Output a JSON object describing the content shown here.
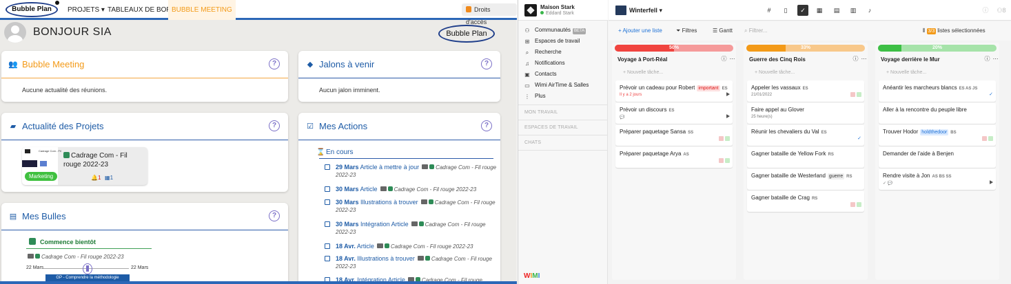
{
  "bubbleplan": {
    "logo": "Bubble Plan",
    "nav": [
      "PROJETS",
      "TABLEAUX DE BORD",
      "BUBBLE MEETING"
    ],
    "access": "Droits d'accès",
    "greeting": "BONJOUR  SIA",
    "logo2": "Bubble Plan",
    "meeting": {
      "title": "Bubble Meeting",
      "empty": "Aucune actualité des réunions."
    },
    "jalons": {
      "title": "Jalons à venir",
      "empty": "Aucun jalon imminent."
    },
    "actualite": {
      "title": "Actualité des Projets",
      "tile": {
        "thumb_text": "Cadrage Com - Fil",
        "name": "Cadrage Com - Fil rouge 2022-23",
        "tag": "Marketing",
        "alerts": "1",
        "events": "1"
      }
    },
    "actions": {
      "title": "Mes Actions",
      "section": "En cours",
      "items": [
        {
          "date": "29 Mars",
          "name": "Article à mettre à jour",
          "project": "Cadrage Com - Fil rouge",
          "project2": "2022-23"
        },
        {
          "date": "30 Mars",
          "name": "Article",
          "project": "Cadrage Com - Fil rouge 2022-23",
          "project2": ""
        },
        {
          "date": "30 Mars",
          "name": "Illustrations à trouver",
          "project": "Cadrage Com - Fil rouge",
          "project2": "2022-23"
        },
        {
          "date": "30 Mars",
          "name": "Intégration Article",
          "project": "Cadrage Com - Fil rouge",
          "project2": "2022-23"
        },
        {
          "date": "18 Avr.",
          "name": "Article",
          "project": "Cadrage Com - Fil rouge 2022-23",
          "project2": ""
        },
        {
          "date": "18 Avr.",
          "name": "Illustrations à trouver",
          "project": "Cadrage Com - Fil rouge",
          "project2": "2022-23"
        },
        {
          "date": "18 Avr.",
          "name": "Intégration Article",
          "project": "Cadrage Com - Fil rouge",
          "project2": ""
        }
      ]
    },
    "bulles": {
      "title": "Mes Bulles",
      "section": "Commence bientôt",
      "project": "Cadrage Com - Fil rouge 2022-23",
      "date_start": "22 Mars",
      "date_end": "22 Mars",
      "bar": "GP - Comprendre la méthodologie"
    }
  },
  "wimi": {
    "workspace": "Maison Stark",
    "user": "Eddard Stark",
    "nav": [
      {
        "label": "Communautés",
        "badge": "BETA",
        "icon": "communities-icon"
      },
      {
        "label": "Espaces de travail",
        "icon": "grid-icon"
      },
      {
        "label": "Recherche",
        "icon": "search-icon"
      },
      {
        "label": "Notifications",
        "icon": "bell-icon"
      },
      {
        "label": "Contacts",
        "icon": "contacts-icon"
      },
      {
        "label": "Wimi AirTime & Salles",
        "icon": "video-icon"
      },
      {
        "label": "Plus",
        "icon": "more-icon"
      }
    ],
    "sections": [
      "MON TRAVAIL",
      "ESPACES DE TRAVAIL",
      "CHATS"
    ],
    "logo": [
      "W",
      "I",
      "M",
      "I"
    ],
    "project_title": "Winterfell",
    "toolbar": {
      "add_list": "+ Ajouter une liste",
      "filters": "Filtres",
      "gantt": "Gantt",
      "filter_placeholder": "Filtrer...",
      "selected_count": "3/3",
      "selected_label": "listes sélectionnées"
    },
    "top_badge": "8",
    "new_task": "+ Nouvelle tâche...",
    "colors": {
      "red": "#f0443f",
      "orange": "#f39a18",
      "green": "#3dbf45"
    },
    "columns": [
      {
        "title": "Voyage à Port-Réal",
        "progress_label": "50%",
        "progress": 50,
        "color": "#f0443f",
        "track": "#f59a9a",
        "tasks": [
          {
            "title": "Prévoir un cadeau pour Robert",
            "tag": "important",
            "tag_color": "red",
            "initials": "ES",
            "meta": "Il y a 2 jours",
            "meta_red": true,
            "icons": [
              "play"
            ]
          },
          {
            "title": "Prévoir un discours",
            "initials": "ES",
            "meta": "💬",
            "icons": [
              "play"
            ]
          },
          {
            "title": "Préparer paquetage Sansa",
            "initials": "SS",
            "icons": [
              "r",
              "g"
            ]
          },
          {
            "title": "Préparer paquetage Arya",
            "initials": "AS",
            "icons": [
              "r",
              "g"
            ]
          }
        ]
      },
      {
        "title": "Guerre des Cinq Rois",
        "progress_label": "33%",
        "progress": 33,
        "color": "#f39a18",
        "track": "#f8c88a",
        "tasks": [
          {
            "title": "Appeler les vassaux",
            "initials": "ES",
            "meta": "21/01/2022",
            "icons": [
              "r",
              "g"
            ]
          },
          {
            "title": "Faire appel au Glover",
            "meta": "25 heure(s)",
            "icons": []
          },
          {
            "title": "Réunir les chevaliers du Val",
            "initials": "ES",
            "icons": [
              "chk"
            ]
          },
          {
            "title": "Gagner bataille de Yellow Fork",
            "initials": "RS",
            "icons": []
          },
          {
            "title": "Gagner bataille de Westerland",
            "tag": "guerre",
            "tag_color": "gray",
            "initials": "RS",
            "icons": []
          },
          {
            "title": "Gagner bataille de Crag",
            "initials": "RS",
            "icons": [
              "r",
              "g"
            ]
          }
        ]
      },
      {
        "title": "Voyage derrière le Mur",
        "progress_label": "20%",
        "progress": 20,
        "color": "#3dbf45",
        "track": "#a6e3a9",
        "tasks": [
          {
            "title": "Anéantir les marcheurs blancs",
            "initials": "ES  AS  JS",
            "icons": [
              "chk"
            ]
          },
          {
            "title": "Aller à la rencontre du peuple libre",
            "icons": []
          },
          {
            "title": "Trouver Hodor",
            "tag": "holdthedoor",
            "tag_color": "blue",
            "initials": "BS",
            "icons": [
              "r",
              "g"
            ]
          },
          {
            "title": "Demander de l'aide à Benjen",
            "icons": []
          },
          {
            "title": "Rendre visite à Jon",
            "initials": "AS  BS  SS",
            "meta": "✓ 💬",
            "icons": [
              "play"
            ]
          }
        ]
      }
    ]
  }
}
